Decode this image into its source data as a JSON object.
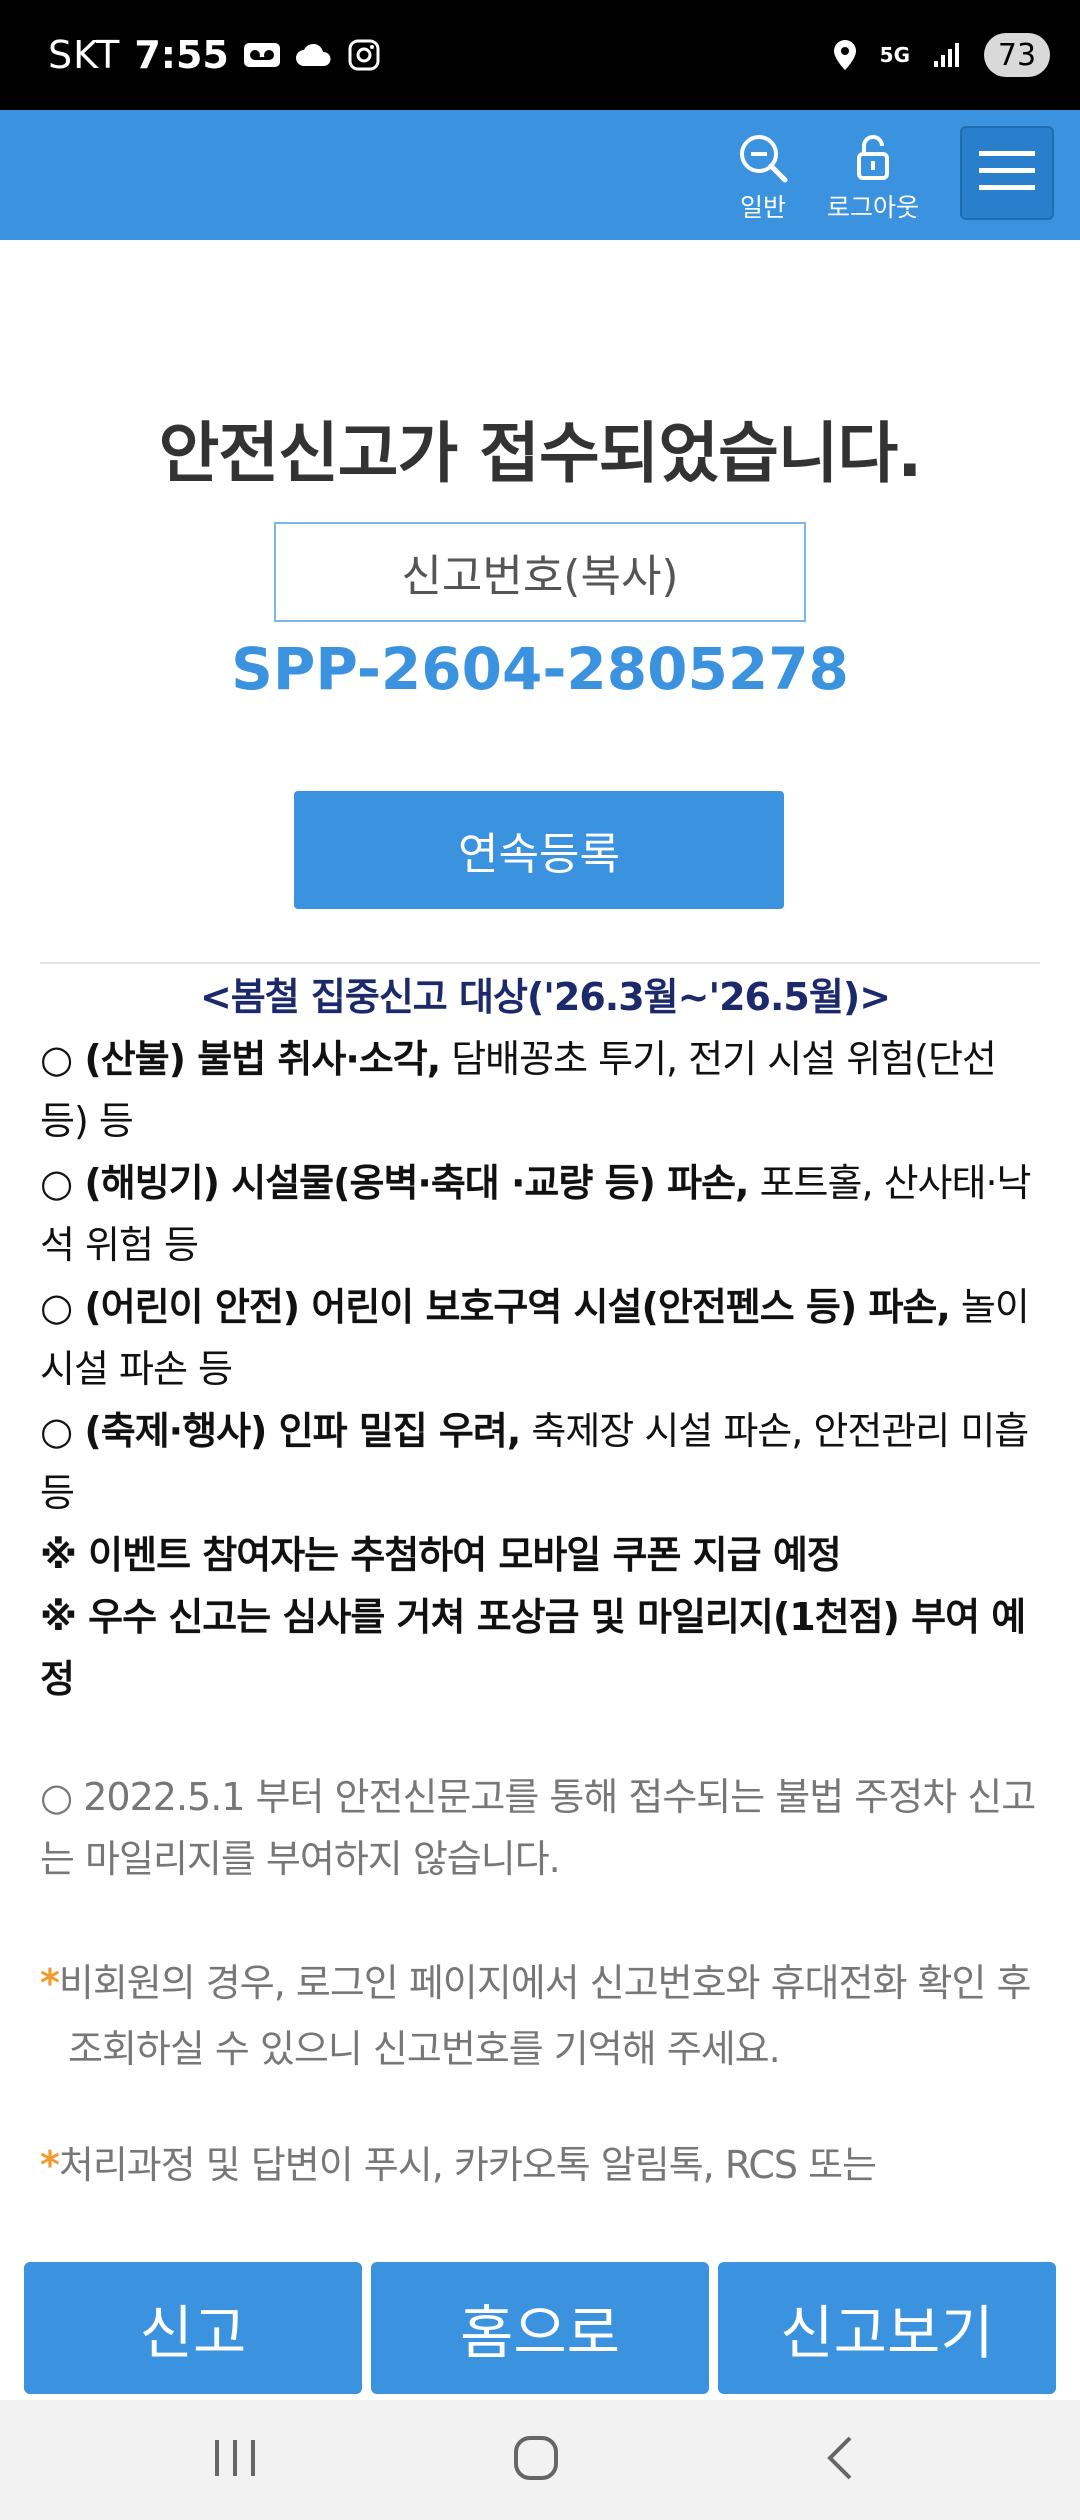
{
  "status_bar": {
    "carrier": "SKT",
    "time": "7:55",
    "network": "5G",
    "battery": "73"
  },
  "header": {
    "search_label": "일반",
    "logout_label": "로그아웃"
  },
  "main": {
    "title": "안전신고가 접수되었습니다.",
    "copy_button": "신고번호(복사)",
    "report_number": "SPP-2604-2805278",
    "continue_button": "연속등록"
  },
  "notice": {
    "heading": "<봄철 집중신고 대상('26.3월~'26.5월)>",
    "items": [
      {
        "bold": "○ (산불) 불법 취사·소각,",
        "rest": " 담배꽁초 투기, 전기 시설 위험(단선 등) 등"
      },
      {
        "bold": "○ (해빙기) 시설물(옹벽·축대 ·교량 등) 파손,",
        "rest": " 포트홀, 산사태·낙석 위험 등"
      },
      {
        "bold": "○ (어린이 안전) 어린이 보호구역 시설(안전펜스 등) 파손,",
        "rest": " 놀이시설 파손 등"
      },
      {
        "bold": "○ (축제·행사) 인파 밀집 우려,",
        "rest": " 축제장 시설 파손, 안전관리 미흡 등"
      }
    ],
    "event_note": "※ 이벤트 참여자는 추첨하여 모바일 쿠폰 지급 예정",
    "reward_note": "※ 우수 신고는 심사를 거쳐 포상금 및 마일리지(1천점) 부여 예정",
    "parking_note": "○ 2022.5.1 부터 안전신문고를 통해 접수되는 불법 주정차 신고는 마일리지를 부여하지 않습니다.",
    "guest_note": "비회원의 경우, 로그인 페이지에서 신고번호와 휴대전화 확인 후 조회하실 수 있으니 신고번호를 기억해 주세요.",
    "process_note": "처리과정 및 답변이 푸시, 카카오톡 알림톡, RCS 또는"
  },
  "bottom_buttons": {
    "report": "신고",
    "home": "홈으로",
    "view": "신고보기"
  },
  "colors": {
    "primary": "#3b93df",
    "heading_navy": "#1c2a6b",
    "star_orange": "#f29a2e"
  },
  "icons": [
    "voicemail-icon",
    "cloud-icon",
    "instagram-icon",
    "location-icon",
    "signal-icon",
    "search-icon",
    "lock-icon",
    "hamburger-menu-icon",
    "recent-apps-icon",
    "home-icon",
    "back-icon"
  ]
}
